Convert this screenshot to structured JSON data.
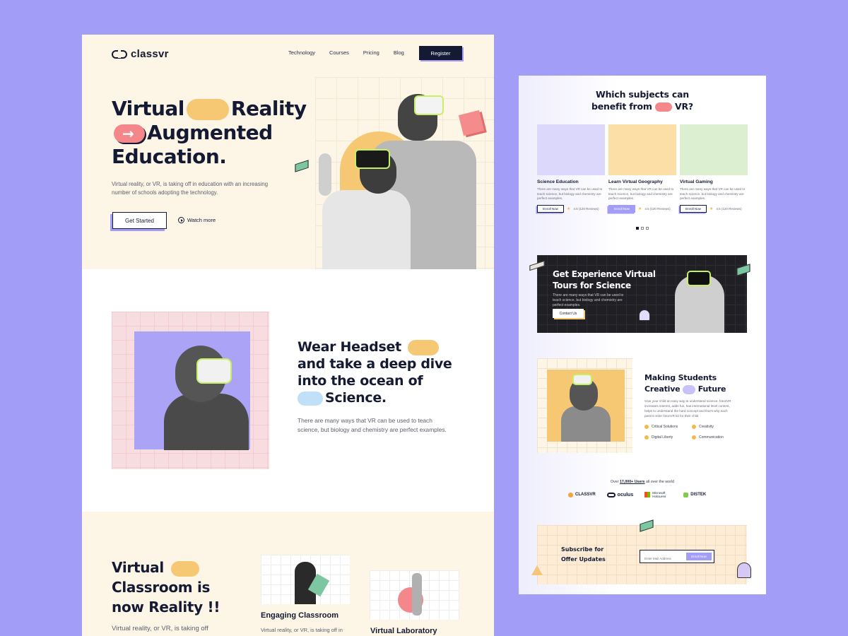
{
  "left": {
    "logo": "classvr",
    "nav": [
      "Technology",
      "Courses",
      "Pricing",
      "Blog"
    ],
    "register": "Register",
    "hero": {
      "line1a": "Virtual",
      "line1b": "Reality",
      "line2": "Augmented",
      "line3": "Education.",
      "desc": "Virtual reality, or VR, is taking off in education with an increasing number of schools adopting the technology.",
      "cta": "Get Started",
      "watch": "Watch more"
    },
    "headset": {
      "l1": "Wear Headset",
      "l2": "and take a deep dive",
      "l3": "into the ocean of",
      "l4": "Science.",
      "desc": "There are many ways that VR can be used to teach science, but biology and chemistry are perfect examples."
    },
    "classroom": {
      "l1": "Virtual",
      "l2": "Classroom is",
      "l3": "now Reality !!",
      "desc": "Virtual reality, or VR, is taking off",
      "card1_title": "Engaging Classroom",
      "card1_desc": "Virtual reality, or VR, is taking off in",
      "card2_title": "Virtual Laboratory"
    }
  },
  "right": {
    "title_l1": "Which subjects can",
    "title_l2a": "benefit from",
    "title_l2b": "VR?",
    "cards": [
      {
        "title": "Science Education",
        "desc": "There are many ways that VR can be used to teach science, but biology and chemistry are perfect examples.",
        "btn": "Enroll Now",
        "rating": "4.5 (120 Reviews)"
      },
      {
        "title": "Learn Virtual Geography",
        "desc": "There are many ways that VR can be used to teach science, but biology and chemistry are perfect examples.",
        "btn": "Enroll Now",
        "rating": "4.5 (120 Reviews)"
      },
      {
        "title": "Virtual Gaming",
        "desc": "There are many ways that VR can be used to teach science, but biology and chemistry are perfect examples.",
        "btn": "Enroll Now",
        "rating": "4.5 (120 Reviews)"
      }
    ],
    "tour": {
      "l1": "Get Experience Virtual",
      "l2": "Tours for Science",
      "desc": "There are many ways that VR can be used to teach science, but biology and chemistry are perfect examples.",
      "btn": "Contact Us"
    },
    "making": {
      "l1": "Making Students",
      "l2a": "Creative",
      "l2b": "Future",
      "desc": "Give your child an easy way to understand science. fotonVR increases interest, adds fun, has international level content, helps to understand the hard concept and that's why each parent order fotonVR kit for their child",
      "features": [
        "Critical Solutions",
        "Creativity",
        "Digital Liberty",
        "Communication"
      ]
    },
    "users": {
      "pre": "Over",
      "count": "17,000+ Users",
      "post": "all over the world"
    },
    "brands": [
      "CLASSVR",
      "oculus",
      "Microsoft HoloLens",
      "DISTEK"
    ],
    "subscribe": {
      "l1": "Subscribe for",
      "l2": "Offer Updates",
      "placeholder": "Enter Mail Address",
      "btn": "Enroll Now"
    }
  },
  "colors": {
    "background": "#a29df7",
    "cream": "#fdf6e6",
    "navy": "#141a33",
    "accent": "#a29df7",
    "yellow": "#f7c873",
    "coral": "#f3878a",
    "lime": "#c6ef62"
  }
}
